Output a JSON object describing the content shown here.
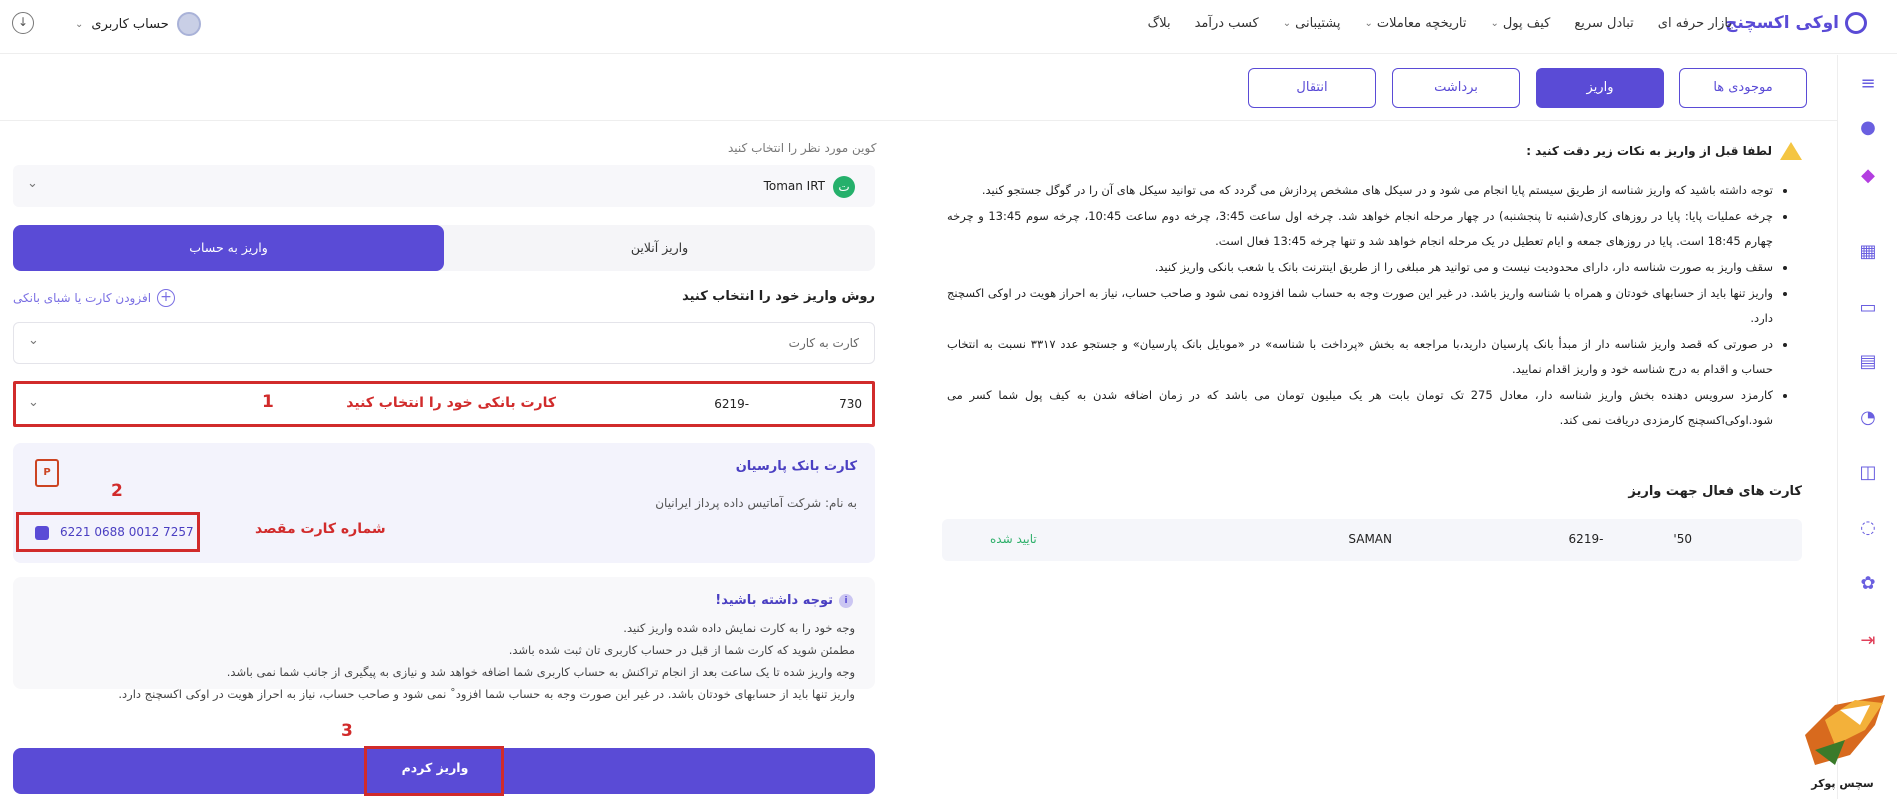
{
  "header": {
    "brand": "اوکی اکسچنج",
    "menu": [
      {
        "label": "بازار حرفه ای",
        "dropdown": false
      },
      {
        "label": "تبادل سریع",
        "dropdown": false
      },
      {
        "label": "کیف پول",
        "dropdown": true
      },
      {
        "label": "تاریخچه معاملات",
        "dropdown": true
      },
      {
        "label": "پشتیبانی",
        "dropdown": true
      },
      {
        "label": "کسب درآمد",
        "dropdown": false
      },
      {
        "label": "بلاگ",
        "dropdown": false
      }
    ],
    "account_label": "حساب کاربری"
  },
  "tabs": [
    {
      "label": "موجودی ها",
      "active": false
    },
    {
      "label": "واریز",
      "active": true
    },
    {
      "label": "برداشت",
      "active": false
    },
    {
      "label": "انتقال",
      "active": false
    }
  ],
  "info": {
    "warning_title": "لطفا قبل از واریز به نکات زیر دقت کنید :",
    "bullets": [
      "توجه داشته باشید که واریز شناسه از طریق سیستم پایا انجام می شود و در سیکل های مشخص پردازش می گردد که می توانید سیکل های آن را در گوگل جستجو کنید.",
      "چرخه عملیات پایا: پایا در روزهای کاری(شنبه تا پنجشنبه) در چهار مرحله انجام خواهد شد. چرخه اول ساعت 3:45، چرخه دوم ساعت 10:45، چرخه سوم 13:45 و چرخه چهارم 18:45 است. پایا در روزهای جمعه و ایام تعطیل در یک مرحله انجام خواهد شد و تنها چرخه 13:45 فعال است.",
      "سقف واریز به صورت شناسه دار، دارای محدودیت نیست و می توانید هر مبلغی را از طریق اینترنت بانک یا شعب بانکی واریز کنید.",
      "واریز تنها باید از حسابهای خودتان و همراه با شناسه واریز باشد. در غیر این صورت وجه به حساب شما افزوده نمی شود و صاحب حساب، نیاز به احراز هویت در اوکی اکسچنج دارد.",
      "در صورتی که قصد واریز شناسه دار از مبدأ بانک پارسیان دارید،با مراجعه به بخش «پرداخت با شناسه» در «موبایل بانک پارسیان» و جستجو عدد ۳۳۱۷ نسبت به انتخاب حساب و اقدام به درج شناسه خود و واریز اقدام نمایید.",
      "کارمزد سرویس دهنده بخش واریز شناسه دار، معادل 275 تک تومان بابت هر یک میلیون تومان می باشد که در زمان اضافه شدن به کیف پول شما کسر می شود.اوکی‌اکسچنج کارمزدی دریافت نمی کند."
    ],
    "active_cards_title": "کارت های فعال جهت واریز",
    "active_card": {
      "number": "6219-",
      "number_tail": "'50",
      "bank": "SAMAN",
      "status": "تایید شده",
      "status_color": "#2fb06b"
    }
  },
  "form": {
    "coin_label": "کوین مورد نظر را انتخاب کنید",
    "coin_value": "Toman IRT",
    "coin_symbol": "ت",
    "method_online": "واریز آنلاین",
    "method_account": "واریز به حساب",
    "method_label": "روش واریز خود را انتخاب کنید",
    "add_card": "افزودن کارت یا شبای بانکی",
    "method_select_value": "کارت به کارت",
    "bank_select_number": "6219-",
    "bank_select_tail": "730",
    "bank_select_hint": "کارت بانکی خود را انتخاب کنید",
    "dest_title": "کارت بانک پارسیان",
    "dest_owner": "به نام: شرکت آماتیس داده پرداز ایرانیان",
    "dest_number": "6221 0688 0012 7257",
    "dest_hint": "شماره کارت مقصد",
    "note_title": "توجه داشته باشید!",
    "note_lines": [
      "وجه خود را به کارت نمایش داده شده واریز کنید.",
      "مطمئن شوید که کارت شما از قبل در حساب کاربری تان ثبت شده باشد.",
      "وجه واریز شده تا یک ساعت بعد از انجام تراکنش به حساب کاربری شما اضافه خواهد شد و نیازی به پیگیری از جانب شما نمی باشد.",
      "واریز تنها باید از حسابهای خودتان باشد. در غیر این صورت وجه به حساب شما افزود˚ نمی شود و صاحب حساب، نیاز به احراز هویت در اوکی اکسچنج دارد."
    ],
    "submit_label": "واریز کردم"
  },
  "annotations": {
    "step1": "1",
    "step2": "2",
    "step3": "3",
    "color": "#d12b2b"
  },
  "watermark": {
    "text": "سچس پوکر"
  },
  "icons": {
    "sidebar": [
      "menu-icon",
      "user-icon",
      "diamond-icon",
      "grid-icon",
      "wallet-icon",
      "calendar-icon",
      "pie-chart-icon",
      "inbox-icon",
      "code-icon",
      "settings-icon",
      "logout-icon"
    ]
  }
}
